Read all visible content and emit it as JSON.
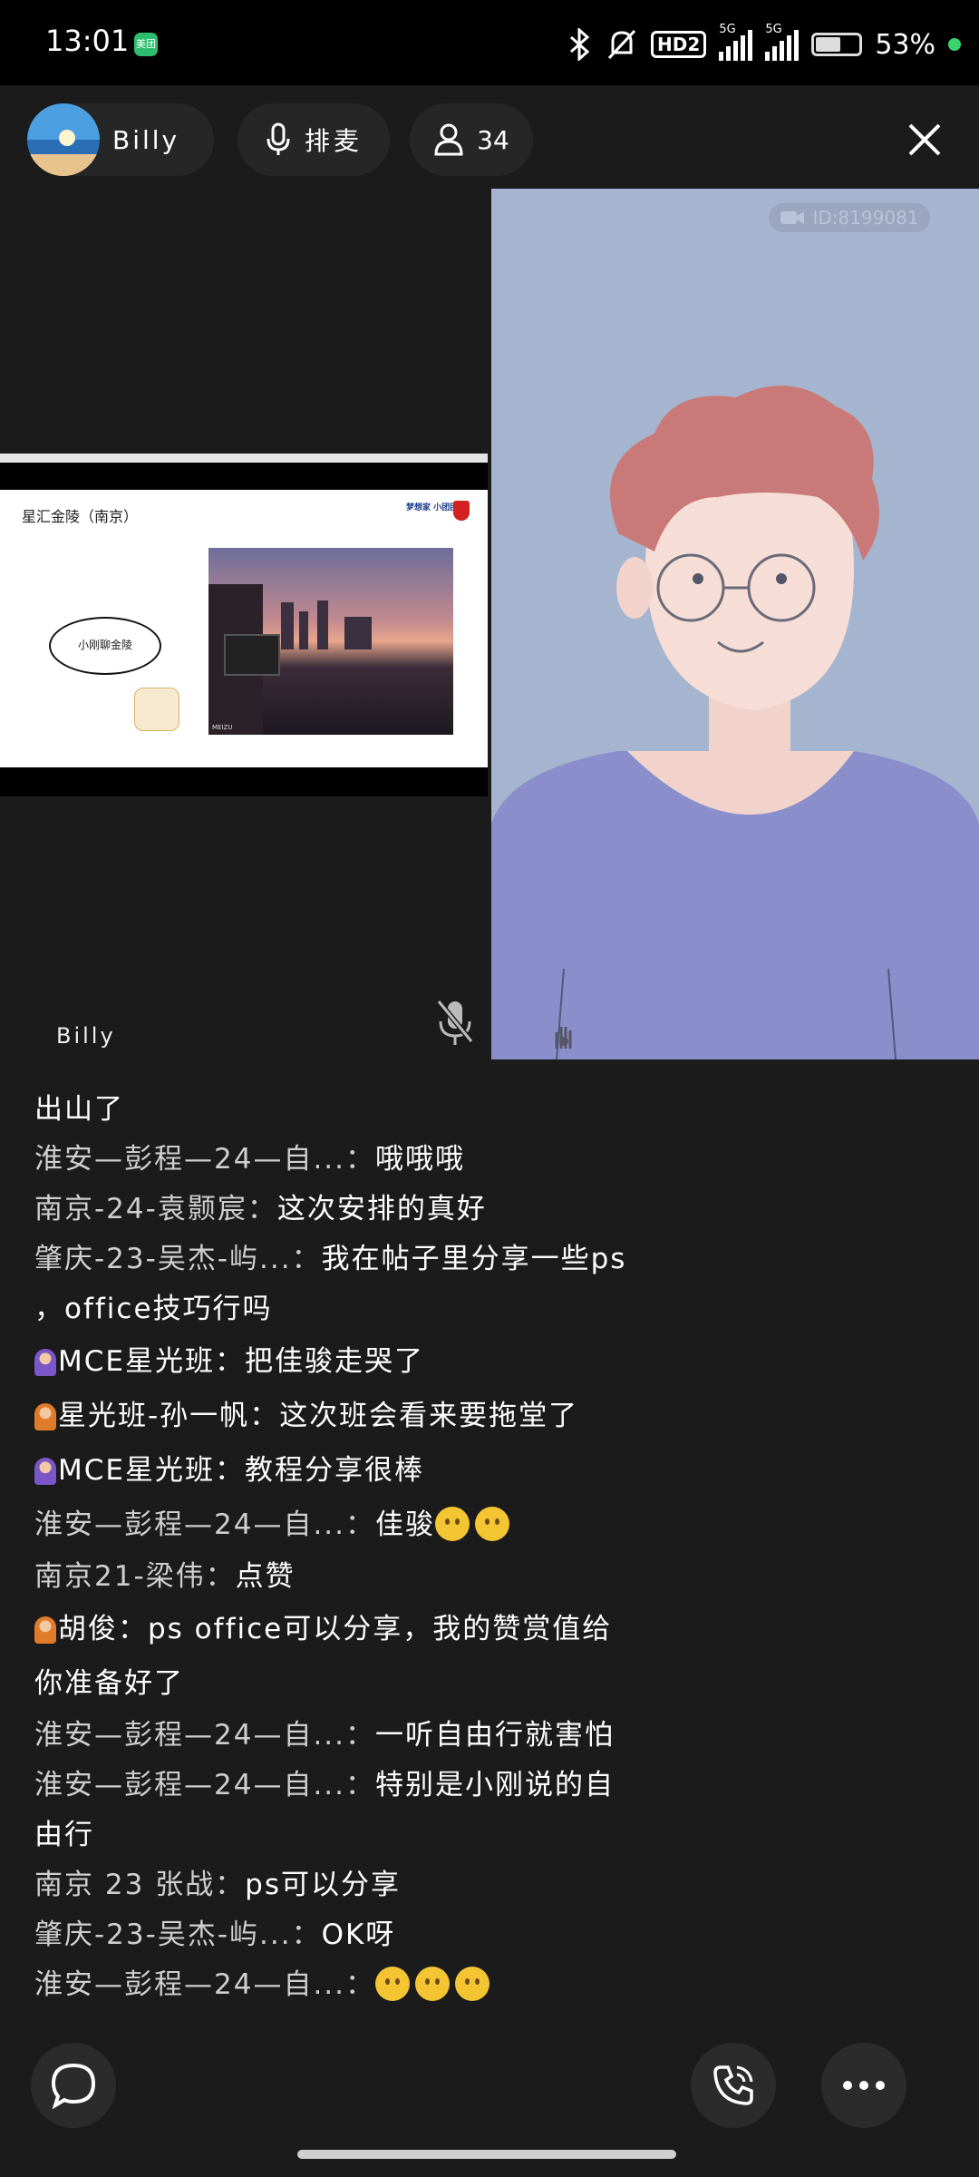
{
  "status_bar": {
    "time": "13:01",
    "app_badge": "美团",
    "hd_label": "HD2",
    "network_1": "5G",
    "network_2": "5G",
    "battery": "53%"
  },
  "header": {
    "host_name": "Billy",
    "mic_queue_label": "排麦",
    "viewer_count": "34"
  },
  "screen_share": {
    "slide_title": "星汇金陵（南京）",
    "slide_logo": "梦想家 小团团",
    "bubble_text": "小刚聊金陵",
    "photo_label": "MEIZU"
  },
  "stage": {
    "participant_name": "Billy",
    "room_id": "ID:8199081"
  },
  "chat": [
    {
      "user": "",
      "text": "出山了",
      "badge": ""
    },
    {
      "user": "淮安—彭程—24—自...",
      "text": "哦哦哦",
      "badge": ""
    },
    {
      "user": "南京-24-袁颢宸",
      "text": "这次安排的真好",
      "badge": ""
    },
    {
      "user": "肇庆-23-吴杰-屿...",
      "text": "我在帖子里分享一些ps",
      "badge": ""
    },
    {
      "user": "",
      "text": "，office技巧行吗",
      "badge": ""
    },
    {
      "user": "MCE星光班",
      "text": "把佳骏走哭了",
      "badge": "purple"
    },
    {
      "user": "星光班-孙一帆",
      "text": "这次班会看来要拖堂了",
      "badge": "orange"
    },
    {
      "user": "MCE星光班",
      "text": "教程分享很棒",
      "badge": "purple"
    },
    {
      "user": "淮安—彭程—24—自...",
      "text": "佳骏",
      "badge": "",
      "emoji_count": 2
    },
    {
      "user": "南京21-梁伟",
      "text": "点赞",
      "badge": ""
    },
    {
      "user": "胡俊",
      "text": "ps office可以分享，我的赞赏值给",
      "badge": "orange"
    },
    {
      "user": "",
      "text": "你准备好了",
      "badge": ""
    },
    {
      "user": "淮安—彭程—24—自...",
      "text": "一听自由行就害怕",
      "badge": ""
    },
    {
      "user": "淮安—彭程—24—自...",
      "text": "特别是小刚说的自",
      "badge": ""
    },
    {
      "user": "",
      "text": "由行",
      "badge": ""
    },
    {
      "user": "南京 23 张战",
      "text": "ps可以分享",
      "badge": ""
    },
    {
      "user": "肇庆-23-吴杰-屿...",
      "text": "OK呀",
      "badge": ""
    },
    {
      "user": "淮安—彭程—24—自...",
      "text": "",
      "badge": "",
      "emoji_count": 3
    }
  ],
  "colors": {
    "background": "#1b1b1b",
    "video_bg": "#a6b5cf",
    "accent_green": "#3ad36b"
  },
  "icons": [
    "bluetooth-icon",
    "mute-bell-icon",
    "signal-icon",
    "battery-icon",
    "mic-icon",
    "person-icon",
    "close-icon",
    "muted-mic-icon",
    "raise-hand-icon",
    "chat-bubble-icon",
    "phone-icon",
    "more-icon"
  ]
}
